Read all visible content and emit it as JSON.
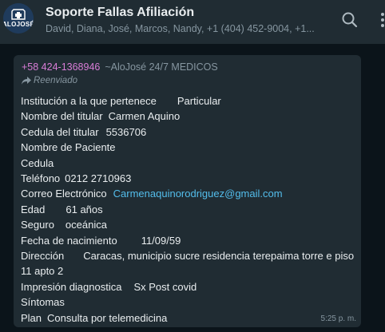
{
  "header": {
    "avatar_text": "ALOJOSÉ",
    "title": "Soporte Fallas Afiliación",
    "subtitle": "David, Diana, José, Marcos, Nandy, +1 (404) 452-9004, +1...",
    "search_icon": "search-icon",
    "menu_icon": "more-vertical-icon"
  },
  "message": {
    "sender_phone": "+58 424-1368946",
    "sender_name": "~AloJosé 24/7 MEDICOS",
    "forwarded_label": "Reenviado",
    "forwarded_icon": "forward-arrow-icon",
    "time": "5:25 p. m.",
    "fields": {
      "institucion_label": "Institución a la que pertenece",
      "institucion_value": "Particular",
      "nombre_titular_label": "Nombre del titular",
      "nombre_titular_value": "Carmen Aquino",
      "cedula_titular_label": "Cedula del titular",
      "cedula_titular_value": "5536706",
      "nombre_paciente_label": "Nombre de Paciente",
      "cedula_label": "Cedula",
      "telefono_label": "Teléfono",
      "telefono_value": "0212 2710963",
      "correo_label": "Correo Electrónico",
      "correo_value": "Carmenaquinorodriguez@gmail.com",
      "edad_label": "Edad",
      "edad_value": "61 años",
      "seguro_label": "Seguro",
      "seguro_value": "oceánica",
      "fecha_label": "Fecha de nacimiento",
      "fecha_value": "11/09/59",
      "direccion_label": "Dirección",
      "direccion_value": "Caracas, municipio sucre residencia terepaima torre e piso 11 apto 2",
      "impresion_label": "Impresión diagnostica",
      "impresion_value": "Sx Post covid",
      "sintomas_label": "Síntomas",
      "plan_label": "Plan",
      "plan_value": "Consulta por telemedicina"
    }
  },
  "colors": {
    "header_bg": "#202c33",
    "chat_bg": "#0b141a",
    "bubble_bg": "#202c33",
    "text": "#e9edef",
    "muted": "#8696a0",
    "sender_phone": "#d97dd7",
    "link": "#53bdeb"
  }
}
